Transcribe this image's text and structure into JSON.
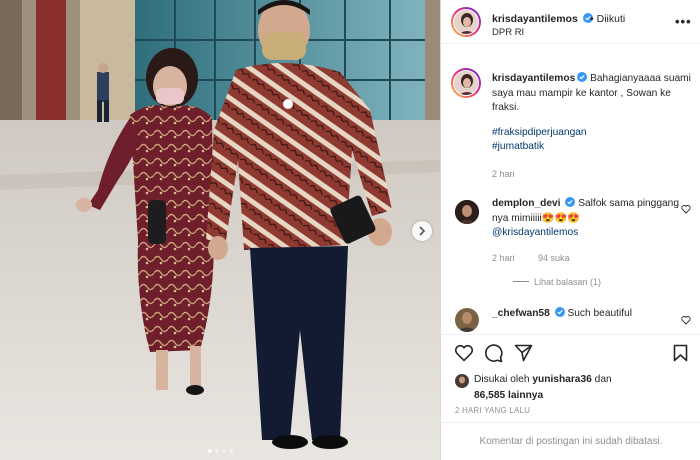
{
  "post": {
    "carousel_dots": 4,
    "active_dot": 0
  },
  "header": {
    "username": "krisdayantilemos",
    "follow_state": "Diikuti",
    "separator": "•",
    "location": "DPR RI",
    "more_icon": "more-dots-icon"
  },
  "caption": {
    "username": "krisdayantilemos",
    "text": "Bahagianyaaaa suami saya mau mampir ke kantor , Sowan ke fraksi.",
    "hashtags": [
      "#fraksipdiperjuangan",
      "#jumatbatik"
    ],
    "time": "2 hari"
  },
  "comments": [
    {
      "username": "demplon_devi",
      "text": "Salfok sama pinggang nya mimiiiii",
      "emoji": "😍😍😍",
      "mention": "@krisdayantilemos",
      "time": "2 hari",
      "likes": "94 suka",
      "view_replies": "Lihat balasan (1)"
    },
    {
      "username": "_chefwan58",
      "text": "Such beautiful",
      "time": ""
    }
  ],
  "actions": {
    "like_icon": "heart-icon",
    "comment_icon": "comment-icon",
    "share_icon": "share-icon",
    "save_icon": "bookmark-icon"
  },
  "likes": {
    "prefix": "Disukai oleh",
    "user": "yunishara36",
    "middle": "dan",
    "count": "86,585",
    "suffix": "lainnya"
  },
  "date": "2 HARI YANG LALU",
  "comments_closed": "Komentar di postingan ini sudah dibatasi.",
  "colors": {
    "border": "#dbdbdb",
    "hashtag": "#00376b",
    "verified": "#3897f0",
    "muted": "#8e8e8e"
  }
}
